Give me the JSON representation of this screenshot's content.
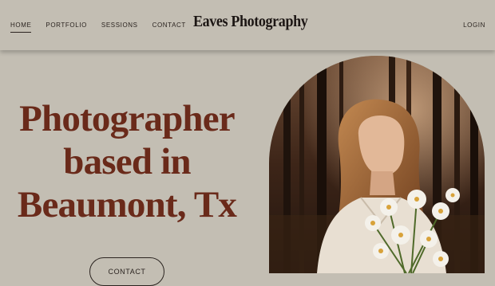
{
  "nav": {
    "items": [
      {
        "label": "HOME",
        "active": true
      },
      {
        "label": "PORTFOLIO",
        "active": false
      },
      {
        "label": "SESSIONS",
        "active": false
      },
      {
        "label": "CONTACT",
        "active": false
      }
    ]
  },
  "header": {
    "logo": "Eaves Photography",
    "login": "LOGIN"
  },
  "hero": {
    "title_lines": [
      "Photographer",
      "based in",
      "Beaumont, Tx"
    ],
    "cta_label": "CONTACT"
  },
  "colors": {
    "background": "#c3beb3",
    "accent": "#6a2a1a",
    "text": "#2b2420"
  }
}
